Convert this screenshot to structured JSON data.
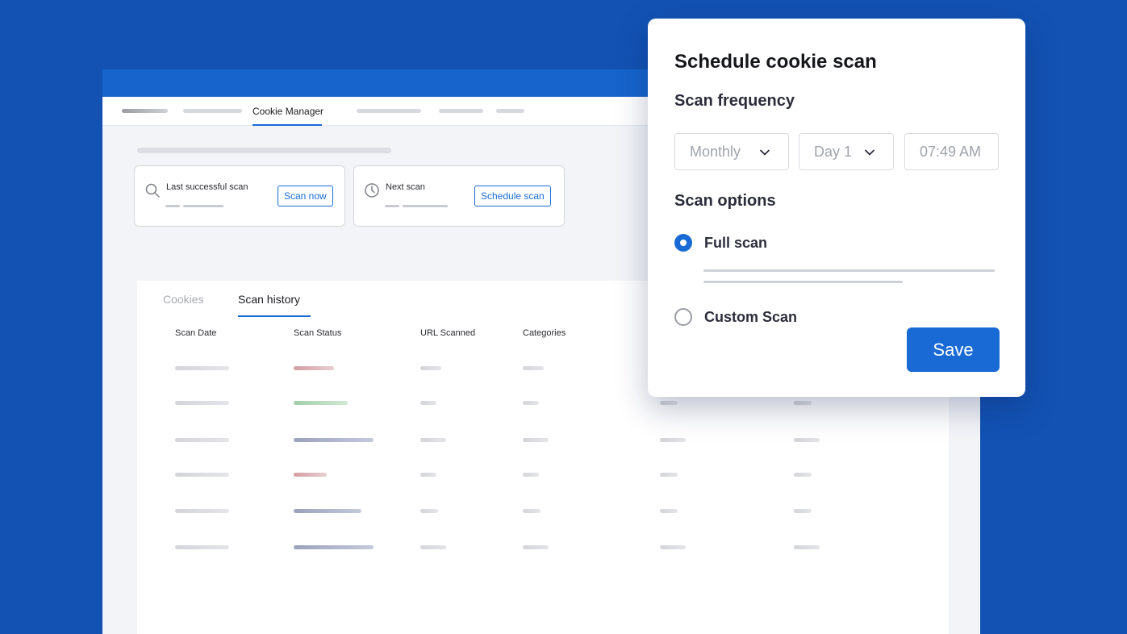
{
  "nav": {
    "active_tab": "Cookie Manager"
  },
  "cards": [
    {
      "title": "Last successful scan",
      "button": "Scan now",
      "icon": "search-icon"
    },
    {
      "title": "Next scan",
      "button": "Schedule scan",
      "icon": "clock-icon"
    }
  ],
  "tabs": {
    "cookies": "Cookies",
    "scan_history": "Scan history"
  },
  "table": {
    "headers": [
      "Scan Date",
      "Scan Status",
      "URL Scanned",
      "Categories"
    ],
    "status_colors": [
      "red",
      "green",
      "navy",
      "red",
      "navy",
      "navy"
    ]
  },
  "modal": {
    "title": "Schedule cookie scan",
    "frequency_label": "Scan frequency",
    "frequency": "Monthly",
    "day": "Day 1",
    "time": "07:49 AM",
    "options_label": "Scan options",
    "options": [
      {
        "label": "Full scan",
        "selected": true
      },
      {
        "label": "Custom Scan",
        "selected": false
      }
    ],
    "save": "Save"
  },
  "colors": {
    "accent": "#1a6ad6",
    "background": "#1352b3",
    "topbar": "#1664cc"
  }
}
